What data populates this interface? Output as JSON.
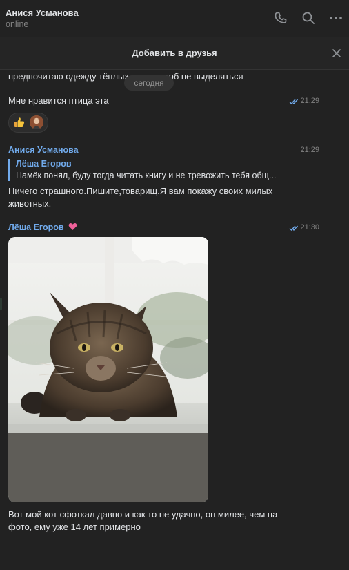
{
  "header": {
    "name": "Анися Усманова",
    "status": "online",
    "icons": [
      "phone-icon",
      "search-icon",
      "more-icon"
    ]
  },
  "friend_bar": {
    "label": "Добавить в друзья",
    "close_icon": "close-icon"
  },
  "chat": {
    "date_label": "сегодня",
    "partial_text": "предпочитаю одежду тёплых тонов, чтоб не выделяться",
    "msg1": {
      "text": "Мне нравится птица эта",
      "time": "21:29",
      "reactions": [
        "thumbs-up",
        "avatar"
      ]
    },
    "msg2": {
      "author": "Анися Усманова",
      "time": "21:29",
      "reply_author": "Лёша Егоров",
      "reply_text": "Намёк понял, буду тогда читать книгу и не тревожить тебя общ...",
      "line1": "Ничего страшного.Пишите,товарищ.Я вам покажу своих милых",
      "line2": "животных."
    },
    "msg3": {
      "author": "Лёша Егоров",
      "author_badge": "heart-icon",
      "time": "21:30",
      "photo": "cat-photo",
      "line1": "Вот мой кот сфоткал давно и как то не удачно, он милее, чем на",
      "line2": "фото, ему уже 14 лет примерно"
    }
  },
  "colors": {
    "background": "#222222",
    "accent": "#71aaeb",
    "text": "#e1e3e6",
    "muted": "#828282"
  }
}
